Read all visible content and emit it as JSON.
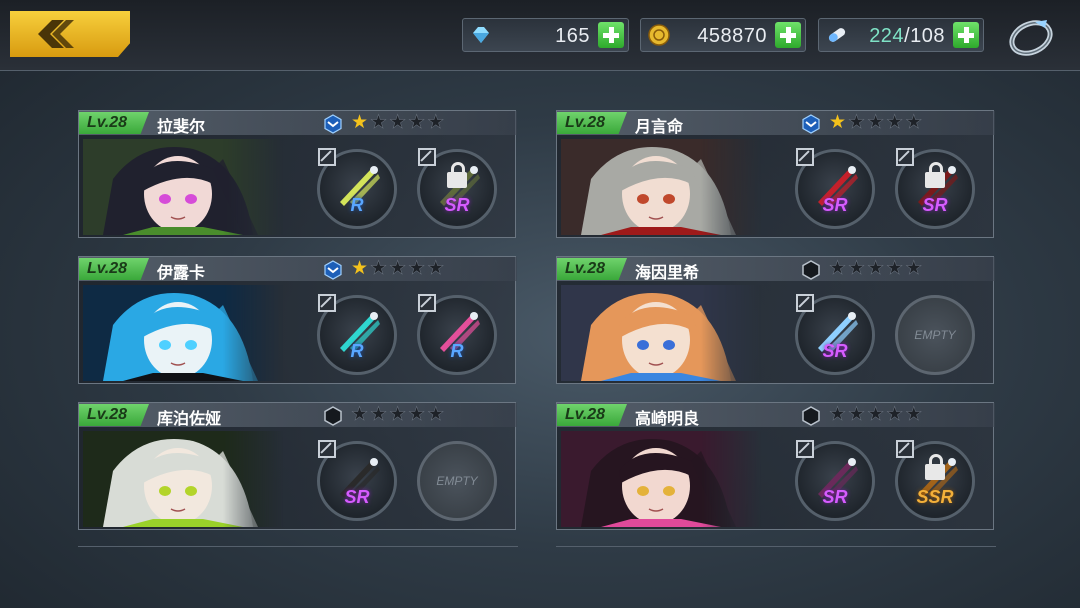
{
  "header": {
    "crystals": "165",
    "gold": "458870",
    "stamina_current": "224",
    "stamina_max": "/108"
  },
  "cards": [
    {
      "level": "Lv.28",
      "name": "拉斐尔",
      "stars_on": 1,
      "rank": "blue",
      "portrait": {
        "hair": "#20212e",
        "skin": "#f1d9d6",
        "eye": "#d64cd8",
        "accent": "#4a8d2c",
        "bg": "#2d3d2a"
      },
      "slots": [
        {
          "rarity": "R",
          "locked": false,
          "color": "#d3e45a"
        },
        {
          "rarity": "SR",
          "locked": true,
          "color": "#5e6b3a"
        }
      ]
    },
    {
      "level": "Lv.28",
      "name": "月言命",
      "stars_on": 1,
      "rank": "blue",
      "portrait": {
        "hair": "#a8a9a4",
        "skin": "#f1ddd2",
        "eye": "#c0482c",
        "accent": "#9e1a1a",
        "bg": "#3a2b2a"
      },
      "slots": [
        {
          "rarity": "SR",
          "locked": false,
          "color": "#c4202a"
        },
        {
          "rarity": "SR",
          "locked": true,
          "color": "#7a1a1a"
        }
      ]
    },
    {
      "level": "Lv.28",
      "name": "伊露卡",
      "stars_on": 1,
      "rank": "blue",
      "portrait": {
        "hair": "#2aa8e4",
        "skin": "#eaf3f7",
        "eye": "#4fd0ff",
        "accent": "#101216",
        "bg": "#0e2a44"
      },
      "slots": [
        {
          "rarity": "R",
          "locked": false,
          "color": "#2fd6d0"
        },
        {
          "rarity": "R",
          "locked": false,
          "color": "#e44f9a"
        }
      ]
    },
    {
      "level": "Lv.28",
      "name": "海因里希",
      "stars_on": 0,
      "rank": "dark",
      "portrait": {
        "hair": "#e5975a",
        "skin": "#f4e0d0",
        "eye": "#3a6fd8",
        "accent": "#3a86e0",
        "bg": "#30364a"
      },
      "slots": [
        {
          "rarity": "SR",
          "locked": false,
          "color": "#8fd0ff"
        },
        {
          "empty": true,
          "label": "EMPTY"
        }
      ]
    },
    {
      "level": "Lv.28",
      "name": "库泊佐娅",
      "stars_on": 0,
      "rank": "dark",
      "portrait": {
        "hair": "#d8dcd6",
        "skin": "#f2e8de",
        "eye": "#b3d42a",
        "accent": "#9ad12a",
        "bg": "#1e2a1a"
      },
      "slots": [
        {
          "rarity": "SR",
          "locked": false,
          "color": "#2a2a2a"
        },
        {
          "empty": true,
          "label": "EMPTY"
        }
      ]
    },
    {
      "level": "Lv.28",
      "name": "高崎明良",
      "stars_on": 0,
      "rank": "dark",
      "portrait": {
        "hair": "#261520",
        "skin": "#f2d8d0",
        "eye": "#e4b23a",
        "accent": "#e04a9a",
        "bg": "#3a1a2e"
      },
      "slots": [
        {
          "rarity": "SR",
          "locked": false,
          "color": "#6a2a5a"
        },
        {
          "rarity": "SSR",
          "locked": true,
          "color": "#a2631a"
        }
      ]
    }
  ]
}
